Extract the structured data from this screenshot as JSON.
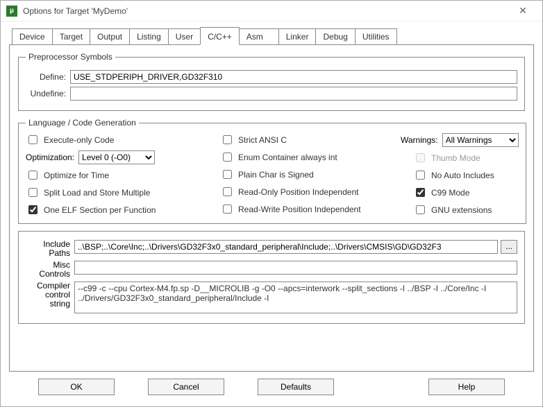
{
  "window": {
    "title": "Options for Target 'MyDemo'"
  },
  "tabs": {
    "items": [
      "Device",
      "Target",
      "Output",
      "Listing",
      "User",
      "C/C++",
      "Asm",
      "Linker",
      "Debug",
      "Utilities"
    ],
    "active": "C/C++"
  },
  "preprocessor": {
    "legend": "Preprocessor Symbols",
    "define_label": "Define:",
    "define_value": "USE_STDPERIPH_DRIVER,GD32F310",
    "undefine_label": "Undefine:",
    "undefine_value": ""
  },
  "langcode": {
    "legend": "Language / Code Generation",
    "execute_only": {
      "label": "Execute-only Code",
      "checked": false
    },
    "optimization_label": "Optimization:",
    "optimization_value": "Level 0 (-O0)",
    "optimize_time": {
      "label": "Optimize for Time",
      "checked": false
    },
    "split_load": {
      "label": "Split Load and Store Multiple",
      "checked": false
    },
    "one_elf": {
      "label": "One ELF Section per Function",
      "checked": true
    },
    "strict_ansi": {
      "label": "Strict ANSI C",
      "checked": false
    },
    "enum_container": {
      "label": "Enum Container always int",
      "checked": false
    },
    "plain_char": {
      "label": "Plain Char is Signed",
      "checked": false
    },
    "readonly_pos": {
      "label": "Read-Only Position Independent",
      "checked": false
    },
    "readwrite_pos": {
      "label": "Read-Write Position Independent",
      "checked": false
    },
    "warnings_label": "Warnings:",
    "warnings_value": "All Warnings",
    "thumb_mode": {
      "label": "Thumb Mode",
      "checked": false,
      "disabled": true
    },
    "no_auto_inc": {
      "label": "No Auto Includes",
      "checked": false
    },
    "c99_mode": {
      "label": "C99 Mode",
      "checked": true
    },
    "gnu_ext": {
      "label": "GNU extensions",
      "checked": false
    }
  },
  "paths": {
    "include_label": "Include\nPaths",
    "include_value": "..\\BSP;..\\Core\\Inc;..\\Drivers\\GD32F3x0_standard_peripheral\\Include;..\\Drivers\\CMSIS\\GD\\GD32F3",
    "misc_label": "Misc\nControls",
    "misc_value": "",
    "compiler_label": "Compiler\ncontrol\nstring",
    "compiler_value": "--c99 -c --cpu Cortex-M4.fp.sp -D__MICROLIB -g -O0 --apcs=interwork --split_sections -I ../BSP -I ../Core/Inc -I ../Drivers/GD32F3x0_standard_peripheral/Include -I"
  },
  "buttons": {
    "ok": "OK",
    "cancel": "Cancel",
    "defaults": "Defaults",
    "help": "Help"
  }
}
